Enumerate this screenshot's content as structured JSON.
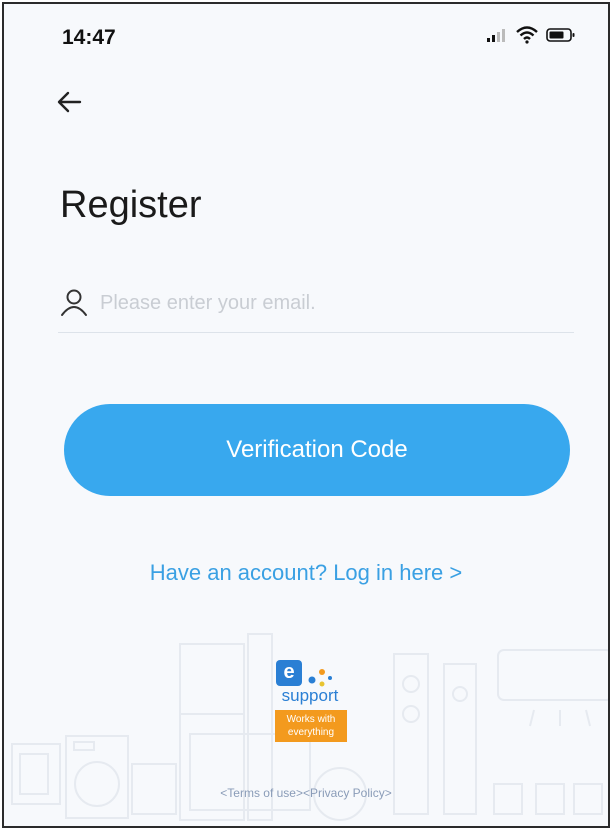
{
  "status_bar": {
    "time": "14:47"
  },
  "page": {
    "title": "Register"
  },
  "email": {
    "placeholder": "Please enter your email.",
    "value": ""
  },
  "actions": {
    "verification_code_label": "Verification Code",
    "login_link_label": "Have an account? Log in here >"
  },
  "branding": {
    "logo_letter": "e",
    "logo_text": "support",
    "badge_text": "Works with everything"
  },
  "footer": {
    "terms_label": "<Terms of use>",
    "privacy_label": "<Privacy Policy>"
  },
  "colors": {
    "accent": "#38a8ee",
    "link": "#3aa0e3",
    "badge": "#f39a1e",
    "logo": "#2a7fd4"
  },
  "icons": {
    "back": "arrow-left-icon",
    "user": "user-icon",
    "signal": "signal-icon",
    "wifi": "wifi-icon",
    "battery": "battery-icon"
  }
}
